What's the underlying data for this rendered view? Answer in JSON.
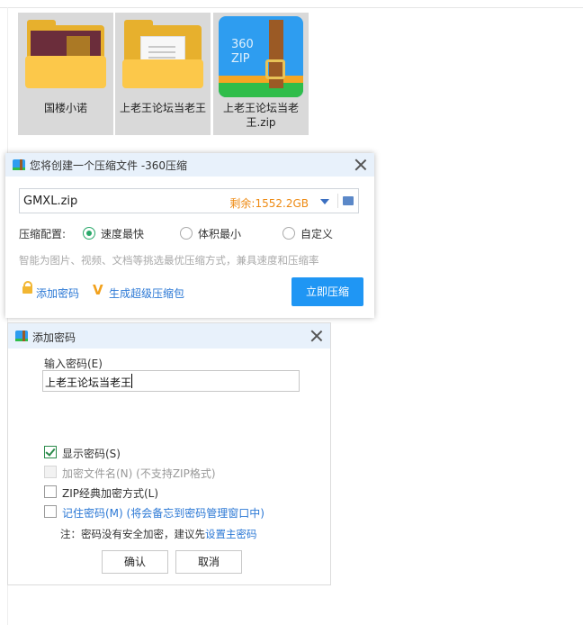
{
  "files": [
    {
      "label": "国楼小诺",
      "icon": "photo-folder-icon"
    },
    {
      "label": "上老王论坛当老王",
      "icon": "document-folder-icon"
    },
    {
      "label": "上老王论坛当老王.zip",
      "icon": "360zip-archive-icon",
      "badge": "360\nZIP"
    }
  ],
  "compress_dialog": {
    "title": "您将创建一个压缩文件 -360压缩",
    "filename": "GMXL.zip",
    "remaining": "剩余:1552.2GB",
    "config_label": "压缩配置:",
    "options": [
      {
        "label": "速度最快",
        "selected": true
      },
      {
        "label": "体积最小",
        "selected": false
      },
      {
        "label": "自定义",
        "selected": false
      }
    ],
    "hint": "智能为图片、视频、文档等挑选最优压缩方式，兼具速度和压缩率",
    "add_password": "添加密码",
    "super_zip": "生成超级压缩包",
    "compress_now": "立即压缩"
  },
  "password_dialog": {
    "title": "添加密码",
    "input_label": "输入密码(E)",
    "password_value": "上老王论坛当老王",
    "checkboxes": [
      {
        "label": "显示密码(S)",
        "checked": true,
        "disabled": false
      },
      {
        "label": "加密文件名(N) (不支持ZIP格式)",
        "checked": false,
        "disabled": true
      },
      {
        "label": "ZIP经典加密方式(L)",
        "checked": false,
        "disabled": false
      },
      {
        "label": "记住密码(M) (将会备忘到密码管理窗口中)",
        "checked": false,
        "disabled": false
      }
    ],
    "note_prefix": "注：密码没有安全加密，建议先",
    "note_link": "设置主密码",
    "ok": "确认",
    "cancel": "取消"
  },
  "colors": {
    "accent": "#1f96f4",
    "title_bar": "#e8f1fb",
    "link": "#2b78d5",
    "remaining": "#ee8a12",
    "radio_on": "#2aa86a",
    "folder": "#fcc84a"
  }
}
